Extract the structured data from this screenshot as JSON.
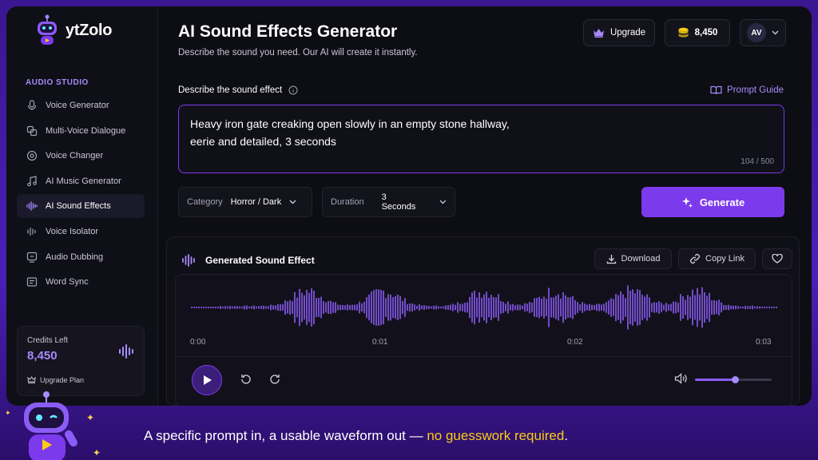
{
  "app": {
    "name": "ytZolo"
  },
  "sidebar": {
    "section_label": "AUDIO STUDIO",
    "items": [
      {
        "label": "Voice Generator",
        "icon": "microphone-icon",
        "active": false
      },
      {
        "label": "Multi-Voice Dialogue",
        "icon": "people-icon",
        "active": false
      },
      {
        "label": "Voice Changer",
        "icon": "voice-changer-icon",
        "active": false
      },
      {
        "label": "AI Music Generator",
        "icon": "music-note-icon",
        "active": false
      },
      {
        "label": "AI Sound Effects",
        "icon": "soundwave-icon",
        "active": true
      },
      {
        "label": "Voice Isolator",
        "icon": "isolator-wave-icon",
        "active": false
      },
      {
        "label": "Audio Dubbing",
        "icon": "dubbing-icon",
        "active": false
      },
      {
        "label": "Word Sync",
        "icon": "word-sync-icon",
        "active": false
      }
    ],
    "credits": {
      "label": "Credits Left",
      "value": "8,450",
      "upgrade_label": "Upgrade Plan"
    }
  },
  "header": {
    "title": "AI Sound Effects Generator",
    "subtitle": "Describe the sound you need. Our AI will create it instantly.",
    "upgrade_label": "Upgrade",
    "credits": "8,450",
    "avatar_initials": "AV"
  },
  "prompt": {
    "label": "Describe the sound effect",
    "guide_label": "Prompt Guide",
    "value": "Heavy iron gate creaking open slowly in an empty stone hallway,\n eerie and detailed, 3 seconds",
    "char_count": "104 / 500"
  },
  "options": {
    "category": {
      "label": "Category",
      "value": "Horror / Dark"
    },
    "duration": {
      "label": "Duration",
      "value": "3 Seconds"
    },
    "generate_label": "Generate"
  },
  "result": {
    "title": "Generated Sound Effect",
    "download_label": "Download",
    "copy_label": "Copy Link",
    "time_ticks": [
      "0:00",
      "0:01",
      "0:02",
      "0:03"
    ],
    "volume_fraction": 0.53
  },
  "caption": {
    "text": "A specific prompt in, a usable waveform out — ",
    "highlight": "no guesswork required",
    "end": "."
  },
  "colors": {
    "accent": "#7c3aed",
    "accent_light": "#a78bfa",
    "highlight": "#facc15",
    "background": "#0d0d14"
  }
}
